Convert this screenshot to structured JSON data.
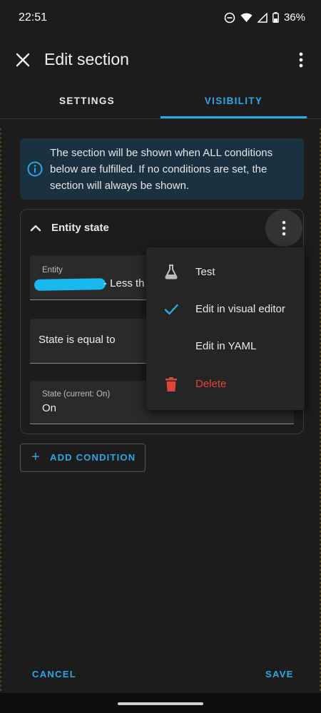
{
  "status_bar": {
    "time": "22:51",
    "battery": "36%"
  },
  "app_bar": {
    "title": "Edit section"
  },
  "tabs": [
    {
      "label": "SETTINGS",
      "selected": false
    },
    {
      "label": "VISIBILITY",
      "selected": true
    }
  ],
  "info": {
    "text": "The section will be shown when ALL conditions below are fulfilled. If no conditions are set, the section will always be shown."
  },
  "condition": {
    "title": "Entity state",
    "entity": {
      "label": "Entity",
      "value": "- Less th"
    },
    "state_operator": {
      "value": "State is equal to"
    },
    "state": {
      "label": "State (current: On)",
      "value": "On"
    }
  },
  "add_condition": {
    "label": "ADD CONDITION"
  },
  "menu": {
    "items": [
      {
        "label": "Test",
        "icon": "flask-icon"
      },
      {
        "label": "Edit in visual editor",
        "icon": "check-icon",
        "checked": true
      },
      {
        "label": "Edit in YAML",
        "icon": "none"
      },
      {
        "label": "Delete",
        "icon": "trash-icon"
      }
    ]
  },
  "footer": {
    "cancel": "CANCEL",
    "save": "SAVE"
  },
  "colors": {
    "accent": "#2aa8e8",
    "danger": "#e0453b",
    "background": "#1c1c1c"
  }
}
